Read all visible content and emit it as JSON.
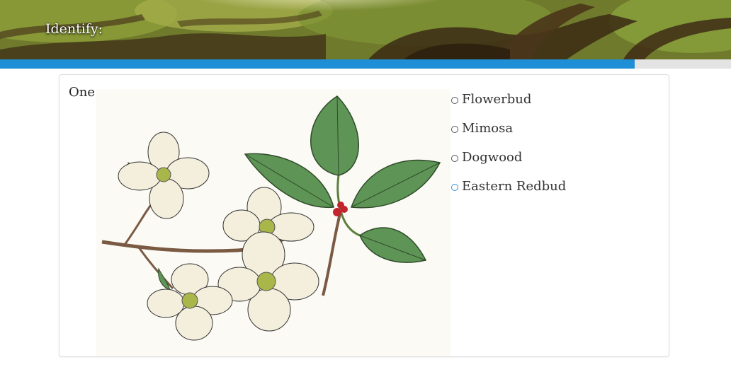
{
  "header": {
    "title": "Identify:"
  },
  "progress": {
    "percent": 86.8,
    "fill_color": "#1e8fd6"
  },
  "question": {
    "title": "One",
    "image_icon": "dogwood-branch-illustration"
  },
  "options": [
    {
      "label": "Flowerbud",
      "hovered": false
    },
    {
      "label": "Mimosa",
      "hovered": false
    },
    {
      "label": "Dogwood",
      "hovered": false
    },
    {
      "label": "Eastern Redbud",
      "hovered": true
    }
  ]
}
